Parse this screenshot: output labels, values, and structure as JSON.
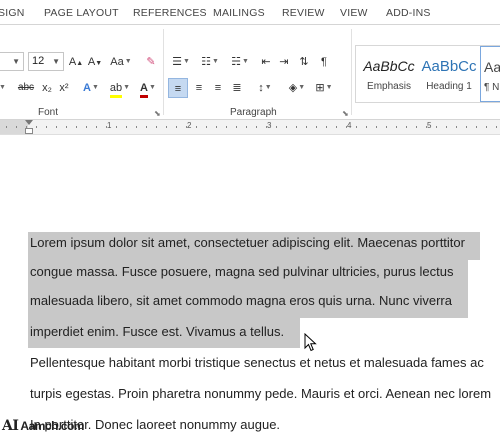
{
  "ribbon_tabs": [
    "SIGN",
    "PAGE LAYOUT",
    "REFERENCES",
    "MAILINGS",
    "REVIEW",
    "VIEW",
    "ADD-INS"
  ],
  "font": {
    "size_value": "12",
    "change_case_label": "Aa",
    "strikethrough_label": "abc",
    "subscript_label": "x₂",
    "superscript_label": "x²",
    "group_label": "Font"
  },
  "paragraph": {
    "group_label": "Paragraph"
  },
  "styles": [
    {
      "sample": "AaBbCc",
      "name": "Emphasis"
    },
    {
      "sample": "AaBbCc",
      "name": "Heading 1"
    },
    {
      "sample": "Aa",
      "name": "¶ N"
    }
  ],
  "ruler_numbers": [
    "1",
    "2",
    "3",
    "4",
    "5"
  ],
  "document": {
    "selected_lines": [
      "Lorem ipsum dolor sit amet, consectetuer adipiscing elit. Maecenas porttitor",
      "congue massa. Fusce posuere, magna sed pulvinar ultricies, purus lectus",
      "malesuada libero, sit amet commodo magna eros quis urna. Nunc viverra",
      "imperdiet enim. Fusce est. Vivamus a tellus."
    ],
    "lines": [
      "Pellentesque habitant morbi tristique senectus et netus et malesuada fames ac",
      "turpis egestas. Proin pharetra nonummy pede. Mauris et orci. Aenean nec lorem",
      "In porttitor. Donec laoreet nonummy augue."
    ]
  },
  "watermark": {
    "logo": "AI",
    "text": "Aamch.com"
  },
  "colors": {
    "selection": "#c8c8c8",
    "active_button": "#c5d9f1",
    "heading1": "#2e74b5",
    "font_color_red": "#c00000",
    "highlight_yellow": "#ffff00"
  }
}
